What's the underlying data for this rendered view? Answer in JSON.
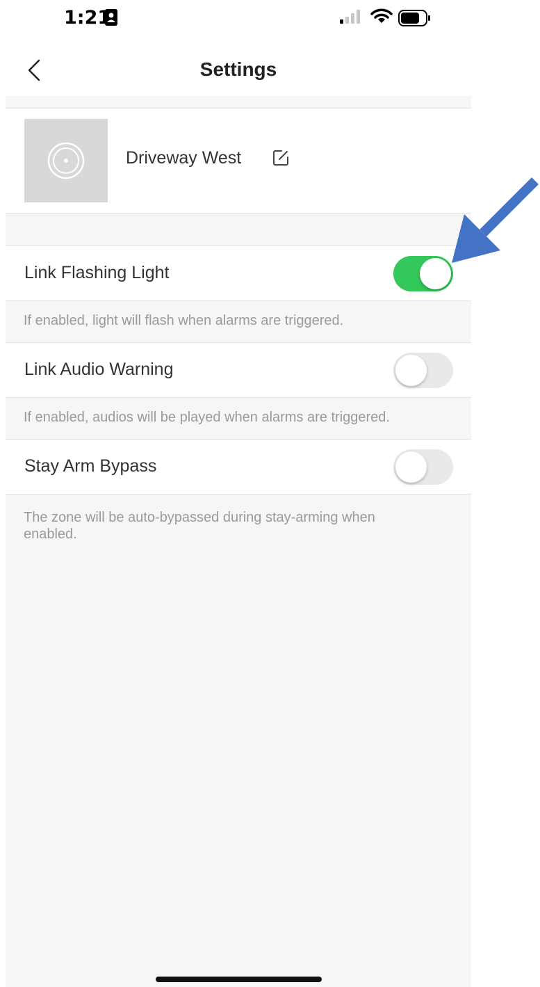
{
  "status_bar": {
    "time": "1:21",
    "icons": [
      "contact-badge-icon",
      "signal-icon",
      "wifi-icon",
      "battery-icon"
    ]
  },
  "nav": {
    "title": "Settings",
    "back_icon": "chevron-left-icon"
  },
  "device": {
    "name": "Driveway West",
    "thumbnail_icon": "camera-lens-icon",
    "edit_icon": "edit-icon"
  },
  "settings": [
    {
      "label": "Link Flashing Light",
      "enabled": true,
      "help": "If enabled, light will flash when alarms are triggered."
    },
    {
      "label": "Link Audio Warning",
      "enabled": false,
      "help": "If enabled, audios will be played when alarms are triggered."
    },
    {
      "label": "Stay Arm Bypass",
      "enabled": false,
      "help": "The zone will be auto-bypassed during stay-arming when enabled."
    }
  ],
  "colors": {
    "toggle_on": "#34c759",
    "toggle_off": "#e9e9ea",
    "background": "#f6f6f6",
    "annotation_arrow": "#4472c4"
  }
}
